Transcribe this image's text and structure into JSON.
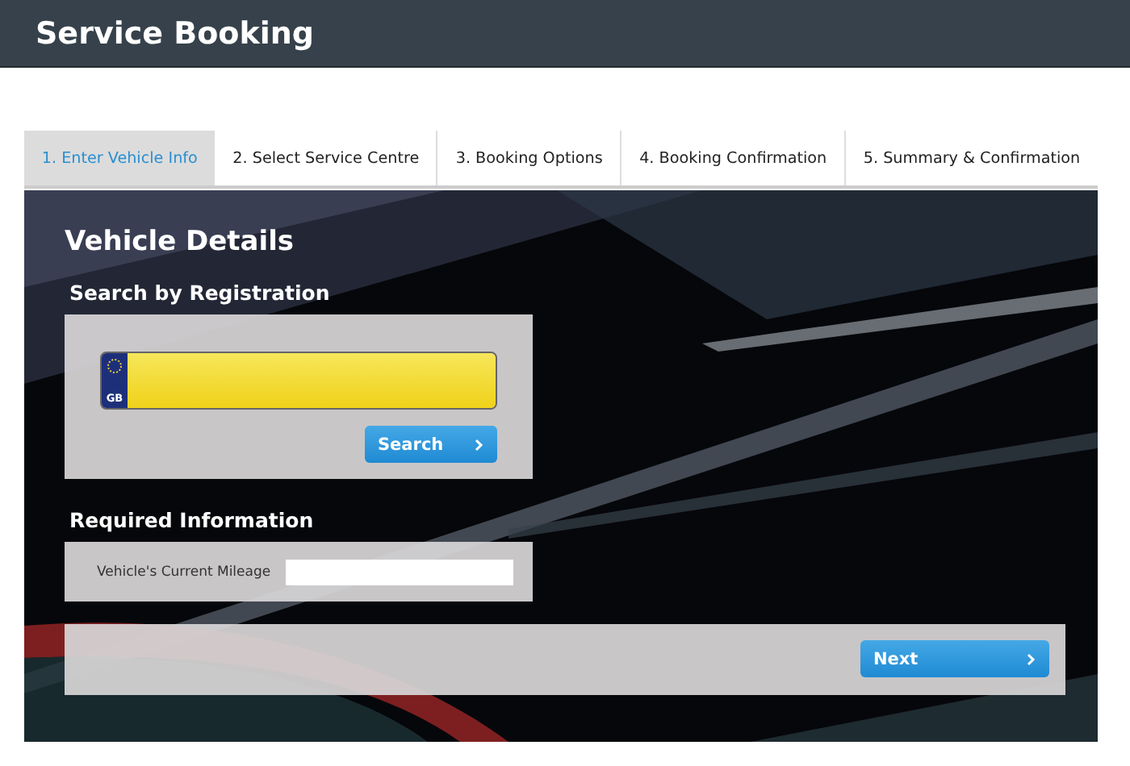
{
  "header": {
    "title": "Service Booking"
  },
  "tabs": [
    {
      "label": "1. Enter Vehicle Info",
      "selected": true
    },
    {
      "label": "2. Select Service Centre",
      "selected": false
    },
    {
      "label": "3. Booking Options",
      "selected": false
    },
    {
      "label": "4. Booking Confirmation",
      "selected": false
    },
    {
      "label": "5. Summary & Confirmation",
      "selected": false
    }
  ],
  "panel": {
    "title": "Vehicle Details",
    "registration": {
      "heading": "Search by Registration",
      "plate_country": "GB",
      "search_button": "Search"
    },
    "required": {
      "heading": "Required Information",
      "mileage_label": "Vehicle's Current Mileage"
    },
    "next_button": "Next"
  }
}
